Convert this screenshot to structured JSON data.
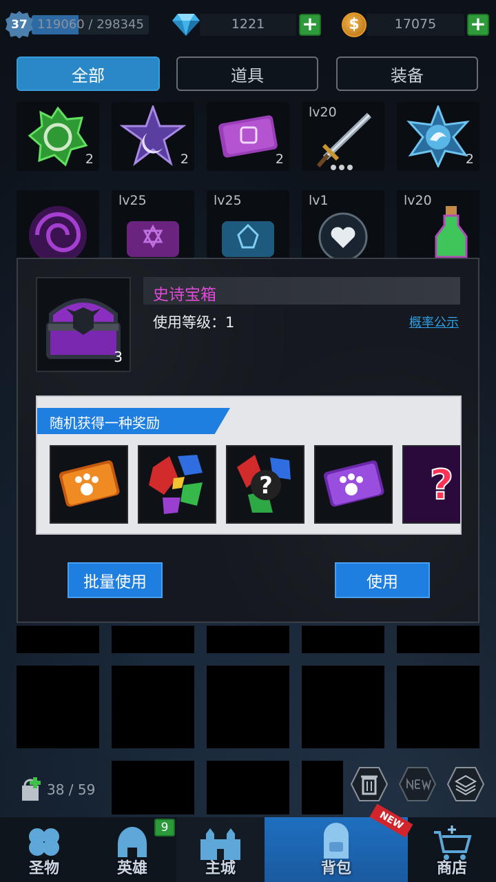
{
  "topbar": {
    "level": "37",
    "exp": "119060 / 298345",
    "exp_fraction": 0.4,
    "gems": "1221",
    "coins": "17075",
    "coin_symbol": "$",
    "plus": "+"
  },
  "tabs": [
    {
      "label": "全部",
      "active": true
    },
    {
      "label": "道具",
      "active": false
    },
    {
      "label": "装备",
      "active": false
    }
  ],
  "inventory_row1": [
    {
      "icon": "green-dragon-emblem-icon",
      "count": "2",
      "lv": ""
    },
    {
      "icon": "purple-moon-star-icon",
      "count": "2",
      "lv": ""
    },
    {
      "icon": "purple-ticket-icon",
      "count": "2",
      "lv": ""
    },
    {
      "icon": "sword-icon",
      "count": "",
      "lv": "lv20"
    },
    {
      "icon": "blue-star-emblem-icon",
      "count": "2",
      "lv": ""
    }
  ],
  "inventory_row2": [
    {
      "icon": "purple-vortex-icon",
      "lv": ""
    },
    {
      "icon": "purple-scroll-icon",
      "lv": "lv25"
    },
    {
      "icon": "blue-scroll-icon",
      "lv": "lv25"
    },
    {
      "icon": "heart-rune-icon",
      "lv": "lv1"
    },
    {
      "icon": "potion-icon",
      "lv": "lv20"
    }
  ],
  "dialog": {
    "item_name": "史诗宝箱",
    "item_count": "3",
    "use_level": "使用等级：1",
    "prob_link": "概率公示",
    "reward_title": "随机获得一种奖励",
    "rewards": [
      "orange-paw-ticket-icon",
      "gem-pile-icon",
      "mystery-gem-icon",
      "purple-paw-ticket-icon",
      "question-mark-icon"
    ],
    "question_mark": "?",
    "batch_button": "批量使用",
    "use_button": "使用"
  },
  "bag": {
    "count": "38 / 59"
  },
  "nav": [
    {
      "label": "圣物",
      "icon": "clover-icon",
      "active": false
    },
    {
      "label": "英雄",
      "icon": "helmet-icon",
      "active": false,
      "badge": "9"
    },
    {
      "label": "主城",
      "icon": "castle-icon",
      "active": false
    },
    {
      "label": "背包",
      "icon": "backpack-icon",
      "active": true,
      "ribbon": "NEW"
    },
    {
      "label": "商店",
      "icon": "cart-icon",
      "active": false
    }
  ],
  "colors": {
    "accent": "#1e7fe0",
    "epic": "#e04ad8",
    "plus_green": "#2f9a3a"
  }
}
